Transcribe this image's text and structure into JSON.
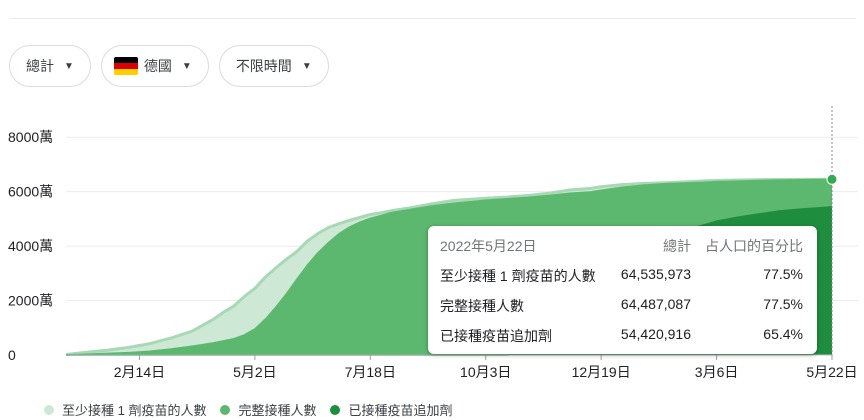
{
  "filters": {
    "metric": "總計",
    "country": "德國",
    "country_flag": [
      "#000000",
      "#DD0000",
      "#FFCE00"
    ],
    "time_range": "不限時間"
  },
  "colors": {
    "series1": "#cde9d5",
    "series1_line": "#a8d8b5",
    "series2": "#5cb86f",
    "series3": "#1e8e3e",
    "marker": "#34a853"
  },
  "tooltip": {
    "date": "2022年5月22日",
    "col_total": "總計",
    "col_pct": "占人口的百分比",
    "rows": [
      {
        "label": "至少接種 1 劑疫苗的人數",
        "total": "64,535,973",
        "pct": "77.5%"
      },
      {
        "label": "完整接種人數",
        "total": "64,487,087",
        "pct": "77.5%"
      },
      {
        "label": "已接種疫苗追加劑",
        "total": "54,420,916",
        "pct": "65.4%"
      }
    ]
  },
  "chart_data": {
    "type": "area",
    "x": [
      "2020-12-27",
      "2021-01-10",
      "2021-01-24",
      "2021-02-07",
      "2021-02-21",
      "2021-03-07",
      "2021-03-21",
      "2021-04-04",
      "2021-04-11",
      "2021-04-18",
      "2021-04-25",
      "2021-05-02",
      "2021-05-09",
      "2021-05-16",
      "2021-05-23",
      "2021-05-30",
      "2021-06-06",
      "2021-06-13",
      "2021-06-20",
      "2021-06-27",
      "2021-07-04",
      "2021-07-11",
      "2021-07-18",
      "2021-07-25",
      "2021-08-01",
      "2021-08-15",
      "2021-08-29",
      "2021-09-12",
      "2021-09-26",
      "2021-10-03",
      "2021-10-17",
      "2021-10-31",
      "2021-11-14",
      "2021-11-28",
      "2021-12-12",
      "2021-12-19",
      "2022-01-02",
      "2022-01-16",
      "2022-01-30",
      "2022-02-13",
      "2022-02-27",
      "2022-03-06",
      "2022-03-20",
      "2022-04-03",
      "2022-04-17",
      "2022-05-01",
      "2022-05-22"
    ],
    "series": [
      {
        "name": "至少接種 1 劑疫苗的人數",
        "values": [
          0.2,
          1.0,
          1.8,
          2.8,
          4.2,
          6.2,
          8.7,
          13.0,
          15.7,
          18.0,
          21.5,
          24.5,
          28.6,
          32.0,
          35.2,
          38.0,
          41.8,
          44.6,
          46.8,
          48.2,
          49.5,
          50.5,
          51.6,
          52.2,
          53.0,
          54.2,
          55.6,
          56.8,
          57.3,
          57.6,
          58.0,
          58.6,
          59.4,
          60.6,
          61.2,
          61.8,
          62.6,
          63.0,
          63.3,
          63.6,
          64.0,
          64.1,
          64.3,
          64.4,
          64.45,
          64.5,
          64.54
        ]
      },
      {
        "name": "完整接種人數",
        "values": [
          0,
          0.3,
          0.6,
          0.9,
          1.4,
          2.2,
          3.2,
          4.4,
          5.2,
          6.0,
          7.4,
          9.6,
          13.2,
          17.6,
          22.5,
          27.8,
          33.0,
          37.5,
          41.2,
          44.5,
          47.0,
          48.8,
          50.2,
          51.2,
          52.3,
          53.6,
          54.8,
          55.8,
          56.5,
          56.9,
          57.4,
          57.9,
          58.6,
          59.4,
          59.9,
          60.5,
          61.6,
          62.4,
          62.9,
          63.2,
          63.5,
          63.7,
          63.9,
          64.1,
          64.3,
          64.4,
          64.49
        ]
      },
      {
        "name": "已接種疫苗追加劑",
        "values": [
          0,
          0,
          0,
          0,
          0,
          0,
          0,
          0,
          0,
          0,
          0,
          0,
          0,
          0,
          0,
          0,
          0,
          0,
          0,
          0,
          0,
          0,
          0,
          0,
          0,
          0,
          0,
          0,
          0,
          0,
          0,
          0.4,
          1.4,
          4.8,
          12.0,
          17.0,
          26.5,
          36.0,
          42.5,
          46.0,
          48.0,
          49.2,
          50.6,
          51.8,
          52.9,
          53.6,
          54.42
        ]
      }
    ],
    "y_ticks": [
      "0",
      "2000萬",
      "4000萬",
      "6000萬",
      "8000萬"
    ],
    "y_tick_values": [
      0,
      20,
      40,
      60,
      80
    ],
    "x_ticks": [
      "2月14日",
      "5月2日",
      "7月18日",
      "10月3日",
      "12月19日",
      "3月6日",
      "5月22日"
    ],
    "x_tick_dates": [
      "2021-02-14",
      "2021-05-02",
      "2021-07-18",
      "2021-10-03",
      "2021-12-19",
      "2022-03-06",
      "2022-05-22"
    ],
    "x_range": [
      "2020-12-27",
      "2022-05-22"
    ],
    "ylim": [
      0,
      90
    ],
    "highlight_date": "2022-05-22",
    "grid": true,
    "legend_position": "bottom"
  },
  "legend": [
    {
      "label": "至少接種 1 劑疫苗的人數",
      "color": "#cde9d5"
    },
    {
      "label": "完整接種人數",
      "color": "#5cb86f"
    },
    {
      "label": "已接種疫苗追加劑",
      "color": "#1e8e3e"
    }
  ]
}
